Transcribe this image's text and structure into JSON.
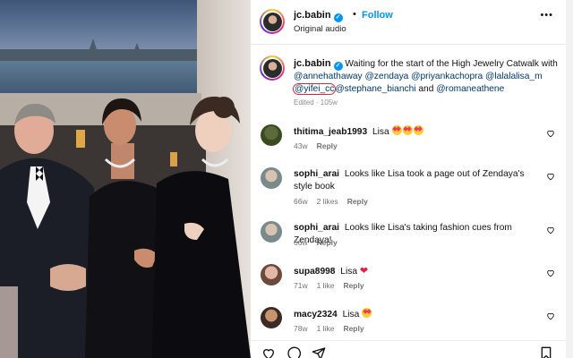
{
  "post_header": {
    "username": "jc.babin",
    "separator": "•",
    "follow_label": "Follow",
    "audio": "Original audio",
    "more_label": "•••"
  },
  "caption": {
    "username": "jc.babin",
    "text_before": "Waiting for the start of the High Jewelry Catwalk with",
    "mentions": [
      "@annehathaway",
      "@zendaya",
      "@priyankachopra",
      "@lalalalisa_m",
      "@yifei_cc",
      "@stephane_bianchi",
      "@romaneathene"
    ],
    "and_word": "and",
    "edited": "Edited",
    "age": "105w"
  },
  "comments": [
    {
      "username": "thitima_jeab1993",
      "text": "Lisa",
      "emoji_count": 3,
      "age": "43w",
      "likes": "",
      "reply_label": "Reply"
    },
    {
      "username": "sophi_arai",
      "text": "Looks like Lisa took a page out of Zendaya's style book",
      "age": "66w",
      "likes": "2 likes",
      "reply_label": "Reply"
    },
    {
      "username": "sophi_arai",
      "text": "Looks like Lisa's taking fashion cues from Zendaya!",
      "age": "66w",
      "likes": "",
      "reply_label": "Reply"
    },
    {
      "username": "supa8998",
      "text": "Lisa",
      "suffix": "❤",
      "age": "71w",
      "likes": "1 like",
      "reply_label": "Reply"
    },
    {
      "username": "macy2324",
      "text": "Lisa",
      "emoji_count": 1,
      "age": "78w",
      "likes": "1 like",
      "reply_label": "Reply"
    }
  ],
  "icons": [
    "heart-icon",
    "comment-icon",
    "share-icon",
    "bookmark-icon",
    "more-icon",
    "verified-badge-icon"
  ],
  "colors": {
    "link_blue": "#0095f6",
    "mention_blue": "#00376b",
    "highlight_red": "#e0262d"
  }
}
